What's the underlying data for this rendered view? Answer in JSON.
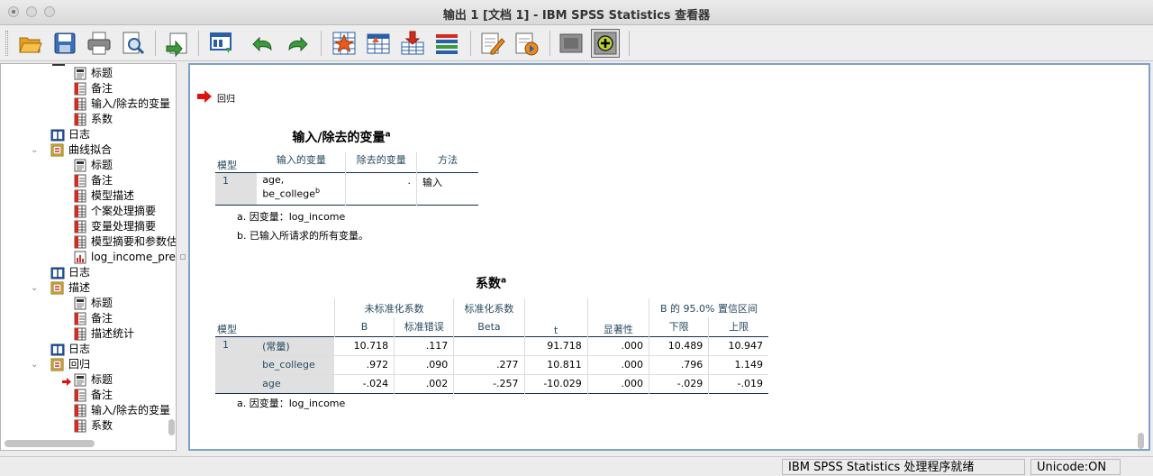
{
  "window": {
    "title": "输出 1 [文档 1] - IBM SPSS Statistics 查看器"
  },
  "toolbar": {
    "icons": [
      "open-icon",
      "save-icon",
      "print-icon",
      "print-preview-icon",
      "export-icon",
      "recall-dialog-icon",
      "undo-icon",
      "redo-icon",
      "go-to-data-icon",
      "go-to-case-icon",
      "go-to-variable-icon",
      "variables-icon",
      "insert-heading-icon",
      "insert-output-icon",
      "show-all-icon",
      "promote-icon"
    ]
  },
  "tree": {
    "items": [
      {
        "label": "标题",
        "icon": "title-doc-icon"
      },
      {
        "label": "备注",
        "icon": "notes-icon"
      },
      {
        "label": "输入/除去的变量",
        "icon": "table-icon"
      },
      {
        "label": "系数",
        "icon": "table-icon"
      },
      {
        "label": "日志",
        "icon": "log-book-icon"
      },
      {
        "label": "曲线拟合",
        "icon": "procedure-icon"
      },
      {
        "label": "标题",
        "icon": "title-doc-icon"
      },
      {
        "label": "备注",
        "icon": "notes-icon"
      },
      {
        "label": "模型描述",
        "icon": "table-icon"
      },
      {
        "label": "个案处理摘要",
        "icon": "table-icon"
      },
      {
        "label": "变量处理摘要",
        "icon": "table-icon"
      },
      {
        "label": "模型摘要和参数估算值",
        "icon": "table-icon"
      },
      {
        "label": "log_income_predict",
        "icon": "chart-icon"
      },
      {
        "label": "日志",
        "icon": "log-book-icon"
      },
      {
        "label": "描述",
        "icon": "procedure-icon"
      },
      {
        "label": "标题",
        "icon": "title-doc-icon"
      },
      {
        "label": "备注",
        "icon": "notes-icon"
      },
      {
        "label": "描述统计",
        "icon": "table-icon"
      },
      {
        "label": "日志",
        "icon": "log-book-icon"
      },
      {
        "label": "回归",
        "icon": "procedure-icon"
      },
      {
        "label": "标题",
        "icon": "title-doc-icon"
      },
      {
        "label": "备注",
        "icon": "notes-icon"
      },
      {
        "label": "输入/除去的变量",
        "icon": "table-icon"
      },
      {
        "label": "系数",
        "icon": "table-icon"
      }
    ]
  },
  "output": {
    "section_label": "回归",
    "t1": {
      "title": "输入/除去的变量",
      "title_sup": "a",
      "headers": [
        "模型",
        "输入的变量",
        "除去的变量",
        "方法"
      ],
      "row": {
        "model": "1",
        "entered_line1": "age,",
        "entered_line2": "be_college",
        "entered_sup": "b",
        "removed": ".",
        "method": "输入"
      },
      "note_a": "a. 因变量：log_income",
      "note_b": "b. 已输入所请求的所有变量。"
    },
    "t2": {
      "title": "系数",
      "title_sup": "a",
      "group_unstd": "未标准化系数",
      "group_std": "标准化系数",
      "group_ci": "B 的 95.0% 置信区间",
      "col_model": "模型",
      "col_b": "B",
      "col_se": "标准错误",
      "col_beta": "Beta",
      "col_t": "t",
      "col_sig": "显著性",
      "col_lower": "下限",
      "col_upper": "上限",
      "model_num": "1",
      "rows": [
        {
          "name": "(常量)",
          "b": "10.718",
          "se": ".117",
          "beta": "",
          "t": "91.718",
          "sig": ".000",
          "lower": "10.489",
          "upper": "10.947"
        },
        {
          "name": "be_college",
          "b": ".972",
          "se": ".090",
          "beta": ".277",
          "t": "10.811",
          "sig": ".000",
          "lower": ".796",
          "upper": "1.149"
        },
        {
          "name": "age",
          "b": "-.024",
          "se": ".002",
          "beta": "-.257",
          "t": "-10.029",
          "sig": ".000",
          "lower": "-.029",
          "upper": "-.019"
        }
      ],
      "note_a": "a. 因变量：log_income"
    }
  },
  "status": {
    "message": "IBM SPSS Statistics 处理程序就绪",
    "unicode": "Unicode:ON"
  }
}
